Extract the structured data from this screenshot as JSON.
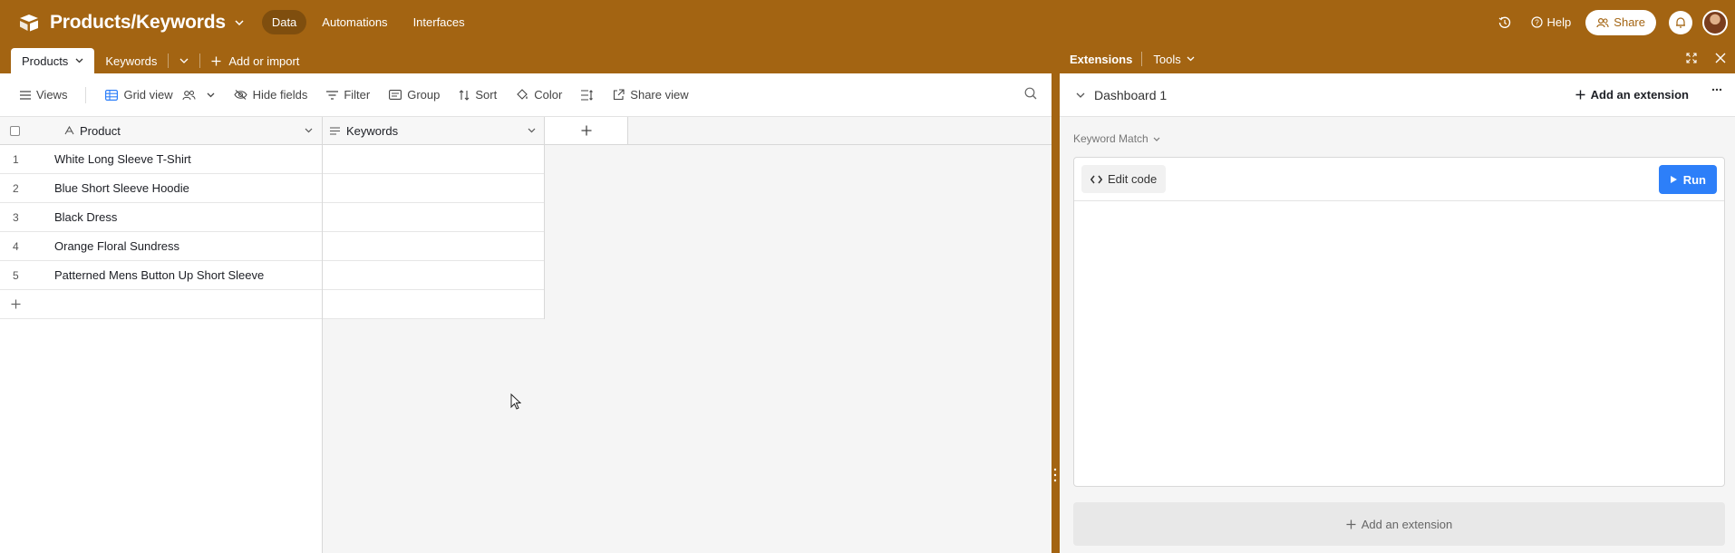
{
  "topbar": {
    "base_title": "Products/Keywords",
    "nav": [
      "Data",
      "Automations",
      "Interfaces"
    ],
    "help_label": "Help",
    "share_label": "Share"
  },
  "tabs": {
    "active": "Products",
    "second": "Keywords",
    "add_import": "Add or import"
  },
  "toolbar": {
    "views": "Views",
    "grid_view": "Grid view",
    "hide_fields": "Hide fields",
    "filter": "Filter",
    "group": "Group",
    "sort": "Sort",
    "color": "Color",
    "share_view": "Share view"
  },
  "table": {
    "columns": [
      "Product",
      "Keywords"
    ],
    "rows": [
      {
        "num": "1",
        "product": "White Long Sleeve T-Shirt",
        "keywords": ""
      },
      {
        "num": "2",
        "product": "Blue Short Sleeve Hoodie",
        "keywords": ""
      },
      {
        "num": "3",
        "product": "Black Dress",
        "keywords": ""
      },
      {
        "num": "4",
        "product": "Orange Floral Sundress",
        "keywords": ""
      },
      {
        "num": "5",
        "product": "Patterned Mens Button Up Short Sleeve",
        "keywords": ""
      }
    ]
  },
  "extensions": {
    "title": "Extensions",
    "tools": "Tools",
    "dashboard": "Dashboard 1",
    "add_extension": "Add an extension",
    "extension_name": "Keyword Match",
    "edit_code": "Edit code",
    "run": "Run",
    "add_extension_bottom": "Add an extension"
  },
  "colors": {
    "brand": "#a36412",
    "run_button": "#2d7ff9"
  }
}
